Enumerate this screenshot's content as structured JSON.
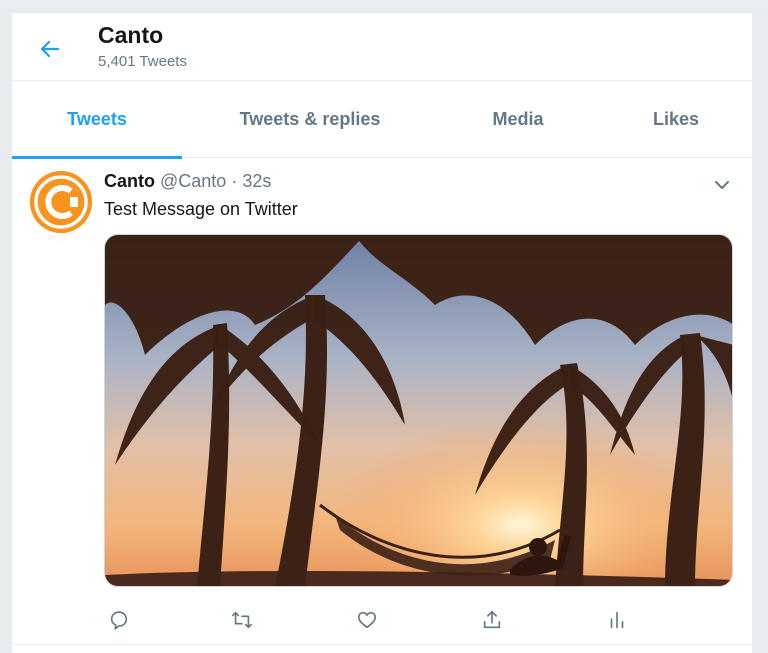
{
  "header": {
    "back_icon": "arrow-left-icon",
    "title": "Canto",
    "subtitle": "5,401 Tweets"
  },
  "tabs": [
    {
      "label": "Tweets",
      "active": true
    },
    {
      "label": "Tweets & replies",
      "active": false
    },
    {
      "label": "Media",
      "active": false
    },
    {
      "label": "Likes",
      "active": false
    }
  ],
  "tweet": {
    "author_name": "Canto",
    "handle": "@Canto",
    "separator": "·",
    "time": "32s",
    "text": "Test Message on Twitter",
    "media_subject": "palm trees and hammock at sunset",
    "actions": [
      "reply-icon",
      "retweet-icon",
      "like-icon",
      "share-icon",
      "analytics-icon"
    ]
  },
  "colors": {
    "accent": "#1da1f2",
    "secondary_text": "#657786",
    "primary_text": "#14171a",
    "avatar_orange": "#f7931e"
  }
}
